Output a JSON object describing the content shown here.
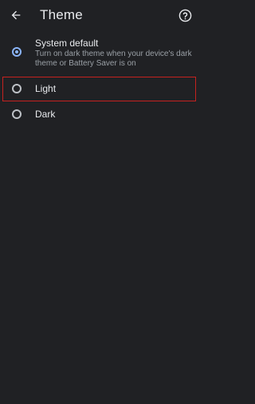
{
  "header": {
    "title": "Theme",
    "back_icon": "arrow-back-icon",
    "help_icon": "help-circle-icon"
  },
  "options": [
    {
      "label": "System default",
      "description": "Turn on dark theme when your device's dark theme or Battery Saver is on",
      "selected": true
    },
    {
      "label": "Light",
      "selected": false
    },
    {
      "label": "Dark",
      "selected": false
    }
  ],
  "colors": {
    "background": "#202124",
    "accent": "#8ab4f8",
    "highlight_border": "#c5221f"
  }
}
